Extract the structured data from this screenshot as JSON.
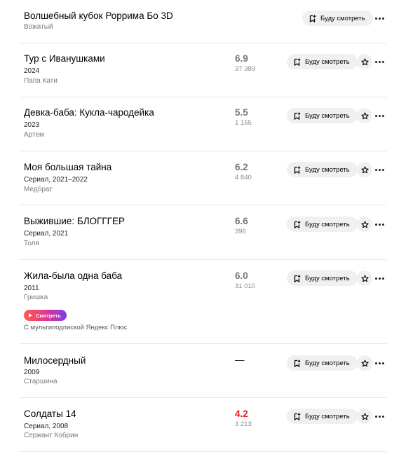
{
  "actions": {
    "watch_later_label": "Буду смотреть",
    "watch_now_label": "Смотреть"
  },
  "items": [
    {
      "title": "Волшебный кубок Роррима Бо 3D",
      "meta": "",
      "role": "Вожатый",
      "rating": "",
      "votes": ""
    },
    {
      "title": "Тур с Иванушками",
      "meta": "2024",
      "role": "Папа Кати",
      "rating": "6.9",
      "votes": "37 389"
    },
    {
      "title": "Девка-баба: Кукла-чародейка",
      "meta": "2023",
      "role": "Артем",
      "rating": "5.5",
      "votes": "1 155"
    },
    {
      "title": "Моя большая тайна",
      "meta": "Сериал, 2021–2022",
      "role": "Медбрат",
      "rating": "6.2",
      "votes": "4 840"
    },
    {
      "title": "Выжившие: БЛОГГГЕР",
      "meta": "Сериал, 2021",
      "role": "Толя",
      "rating": "6.6",
      "votes": "396"
    },
    {
      "title": "Жила-была одна баба",
      "meta": "2011",
      "role": "Гришка",
      "rating": "6.0",
      "votes": "31 010",
      "plus_note": "С мультиподпиской Яндекс Плюс"
    },
    {
      "title": "Милосердный",
      "meta": "2009",
      "role": "Старшина",
      "rating": "—",
      "votes": ""
    },
    {
      "title": "Солдаты 14",
      "meta": "Сериал, 2008",
      "role": "Сержант Кобрин",
      "rating": "4.2",
      "votes": "3 213"
    }
  ],
  "colors": {
    "rating_default": "#777777",
    "rating_low": "#e32020",
    "button_bg": "#f0f0f0",
    "watch_gradient": [
      "#ff5a4e",
      "#e0368f",
      "#7b3bf2"
    ]
  },
  "icons": {
    "watch_later": "bookmark-plus-icon",
    "favorite": "star-icon",
    "more": "more-dots-icon",
    "play": "play-icon"
  }
}
